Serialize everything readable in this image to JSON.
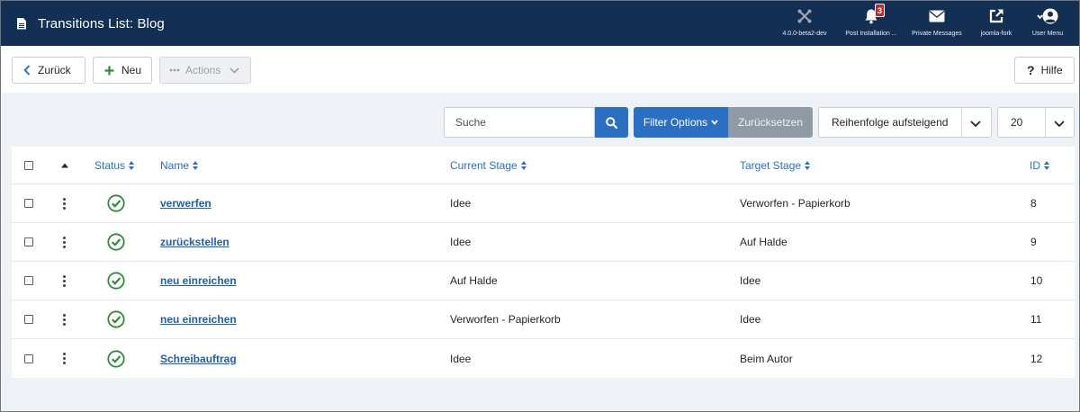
{
  "header": {
    "title": "Transitions List: Blog",
    "items": [
      {
        "label": "4.0.0-beta2-dev",
        "icon": "joomla-icon"
      },
      {
        "label": "Post Installation ...",
        "icon": "bell-icon",
        "badge": "3"
      },
      {
        "label": "Private Messages",
        "icon": "envelope-icon"
      },
      {
        "label": "joomla-fork",
        "icon": "external-link-icon"
      },
      {
        "label": "User Menu",
        "icon": "user-icon"
      }
    ]
  },
  "toolbar": {
    "back_label": "Zurück",
    "new_label": "Neu",
    "actions_label": "Actions",
    "help_label": "Hilfe"
  },
  "filters": {
    "search_placeholder": "Suche",
    "filter_options_label": "Filter Options",
    "reset_label": "Zurücksetzen",
    "ordering_value": "Reihenfolge aufsteigend",
    "limit_value": "20"
  },
  "table": {
    "columns": {
      "status": "Status",
      "name": "Name",
      "current_stage": "Current Stage",
      "target_stage": "Target Stage",
      "id": "ID"
    },
    "rows": [
      {
        "name": "verwerfen",
        "current_stage": "Idee",
        "target_stage": "Verworfen - Papierkorb",
        "id": "8"
      },
      {
        "name": "zurückstellen",
        "current_stage": "Idee",
        "target_stage": "Auf Halde",
        "id": "9"
      },
      {
        "name": "neu einreichen",
        "current_stage": "Auf Halde",
        "target_stage": "Idee",
        "id": "10"
      },
      {
        "name": "neu einreichen",
        "current_stage": "Verworfen - Papierkorb",
        "target_stage": "Idee",
        "id": "11"
      },
      {
        "name": "Schreibauftrag",
        "current_stage": "Idee",
        "target_stage": "Beim Autor",
        "id": "12"
      }
    ]
  },
  "colors": {
    "header_bg": "#132f53",
    "primary": "#2a6fc2",
    "status_green": "#2e8b3a",
    "badge_red": "#c52828"
  }
}
